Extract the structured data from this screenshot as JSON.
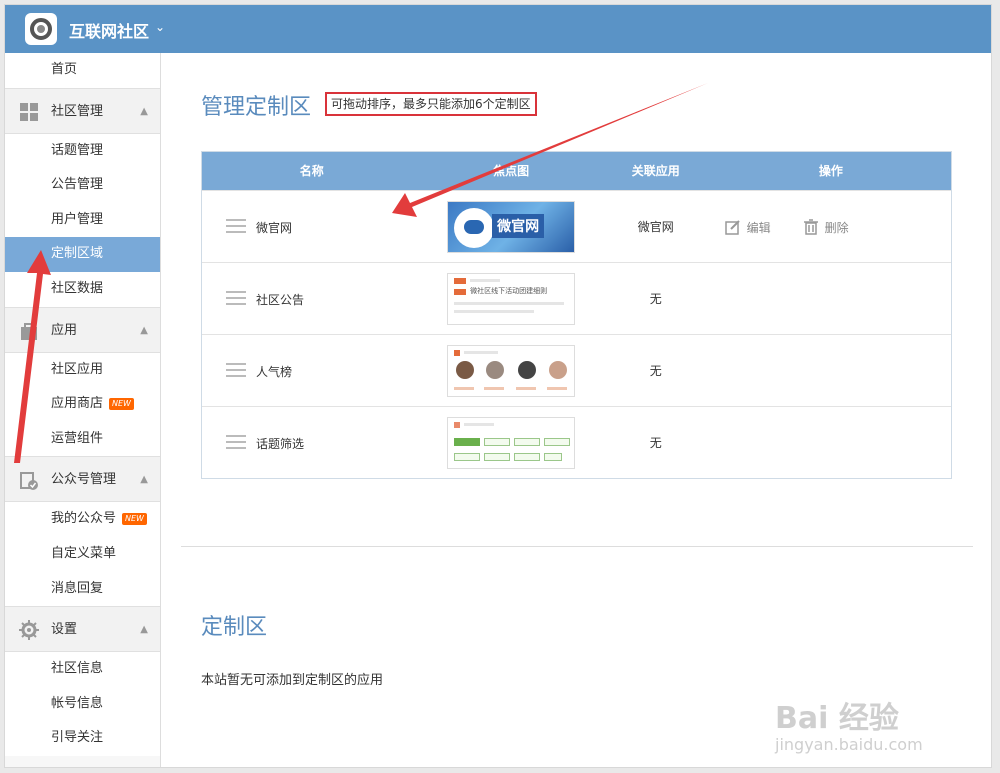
{
  "header": {
    "title": "互联网社区"
  },
  "sidebar": {
    "home": "首页",
    "groups": [
      {
        "label": "社区管理",
        "icon": "grid-icon",
        "items": [
          "话题管理",
          "公告管理",
          "用户管理",
          "定制区域",
          "社区数据"
        ]
      },
      {
        "label": "应用",
        "icon": "bag-icon",
        "items": [
          "社区应用",
          "应用商店",
          "运营组件"
        ]
      },
      {
        "label": "公众号管理",
        "icon": "clipboard-check-icon",
        "items": [
          "我的公众号",
          "自定义菜单",
          "消息回复"
        ]
      },
      {
        "label": "设置",
        "icon": "gear-icon",
        "items": [
          "社区信息",
          "帐号信息",
          "引导关注"
        ]
      }
    ],
    "active_item": "定制区域",
    "new_badge": "NEW"
  },
  "main": {
    "title": "管理定制区",
    "hint": "可拖动排序，最多只能添加6个定制区",
    "table": {
      "headers": [
        "名称",
        "焦点图",
        "关联应用",
        "操作"
      ],
      "rows": [
        {
          "name": "微官网",
          "thumb_label": "微官网",
          "app": "微官网",
          "edit": "编辑",
          "delete": "删除"
        },
        {
          "name": "社区公告",
          "thumb_label": "微社区线下活动团建细则",
          "app": "无"
        },
        {
          "name": "人气榜",
          "thumb_label": "",
          "app": "无"
        },
        {
          "name": "话题筛选",
          "thumb_label": "",
          "app": "无"
        }
      ]
    },
    "section2_title": "定制区",
    "empty_text": "本站暂无可添加到定制区的应用"
  },
  "watermark": {
    "brand": "Bai 经验",
    "url": "jingyan.baidu.com"
  },
  "colors": {
    "topbar": "#5a93c6",
    "accent": "#79a9d8",
    "table_head": "#7aa9d6",
    "hint_border": "#d9333a",
    "arrow": "#e23c3c"
  }
}
